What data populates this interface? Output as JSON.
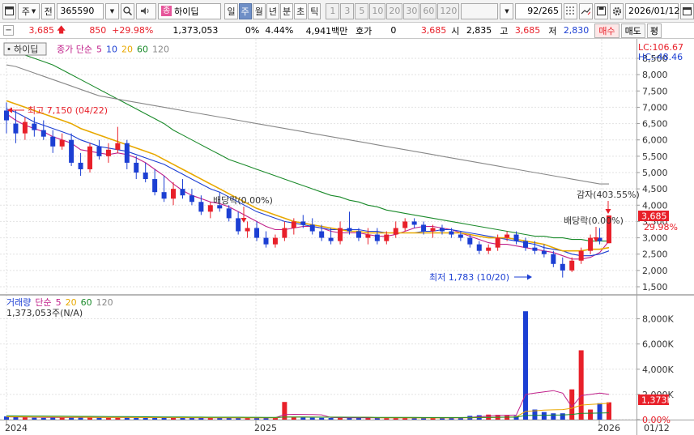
{
  "toolbar": {
    "market_label": "주",
    "all_label": "전",
    "stock_code": "365590",
    "stock_badge": "종",
    "stock_name": "하이딥",
    "periods": [
      "일",
      "주",
      "월",
      "년",
      "분",
      "초",
      "틱"
    ],
    "active_period": "주",
    "minute_opts": [
      "1",
      "3",
      "5",
      "10",
      "20",
      "30",
      "60",
      "120"
    ],
    "page_counter": "92/265",
    "date": "2026/01/12"
  },
  "quote": {
    "price": "3,685",
    "change": "850",
    "change_pct": "+29.98%",
    "volume": "1,373,053",
    "zero_pct": "0%",
    "turnover_pct": "4.44%",
    "amount": "4,941백만",
    "quote_label": "호가",
    "quote_value": "0",
    "quote_price": "3,685",
    "open_label": "시",
    "open": "2,835",
    "high_label": "고",
    "high": "3,685",
    "low_label": "저",
    "low": "2,830",
    "buy_label": "매수",
    "sell_label": "매도",
    "eval_label": "평"
  },
  "price_panel": {
    "name_tag": "하이딥",
    "legend": [
      {
        "text": "종가 단순",
        "color": "#c0208a"
      },
      {
        "text": "5",
        "color": "#c0208a"
      },
      {
        "text": "10",
        "color": "#1c3fd3"
      },
      {
        "text": "20",
        "color": "#e8a800"
      },
      {
        "text": "60",
        "color": "#1a8a2a"
      },
      {
        "text": "120",
        "color": "#888888"
      }
    ],
    "lc": "LC:106.67",
    "hc": "HC:-48.46",
    "high_note": "최고 7,150 (04/22)",
    "low_note": "최저 1,783 (10/20)",
    "div_note1": "배당락(0.00%)",
    "div_note2": "배당락(0.00%)",
    "cap_note": "감자(403.55%)",
    "price_tag": "3,685",
    "pct_tag": "29.98%",
    "y_axis": [
      "8,500",
      "8,000",
      "7,500",
      "7,000",
      "6,500",
      "6,000",
      "5,500",
      "5,000",
      "4,500",
      "4,000",
      "3,500",
      "3,000",
      "2,500",
      "2,000",
      "1,500"
    ]
  },
  "volume_panel": {
    "legend": [
      {
        "text": "거래량",
        "color": "#1c3fd3"
      },
      {
        "text": "단순",
        "color": "#c0208a"
      },
      {
        "text": "5",
        "color": "#c0208a"
      },
      {
        "text": "20",
        "color": "#e8a800"
      },
      {
        "text": "60",
        "color": "#1a8a2a"
      },
      {
        "text": "120",
        "color": "#888888"
      }
    ],
    "vol_text": "1,373,053주(N/A)",
    "y_axis": [
      "8,000K",
      "6,000K",
      "4,000K",
      "2,000K",
      "0.00%"
    ],
    "vol_tag": "1,373K"
  },
  "x_axis": {
    "labels": [
      "2024",
      "2025",
      "2026"
    ],
    "right_label": "01/12"
  },
  "colors": {
    "up": "#e8202a",
    "down": "#1c3fd3",
    "ma5": "#c0208a",
    "ma10": "#1c3fd3",
    "ma20": "#e8a800",
    "ma60": "#1a8a2a",
    "ma120": "#888888"
  },
  "chart_data": {
    "type": "candlestick",
    "x_start": "2024-01",
    "x_end": "2026-01-12",
    "ylim": [
      1500,
      8500
    ],
    "candles": [
      [
        6900,
        7150,
        6200,
        6600
      ],
      [
        6500,
        6900,
        5900,
        6200
      ],
      [
        6200,
        6700,
        6000,
        6550
      ],
      [
        6500,
        6700,
        6100,
        6300
      ],
      [
        6300,
        6600,
        6000,
        6100
      ],
      [
        6100,
        6300,
        5600,
        5800
      ],
      [
        5800,
        6200,
        5700,
        6000
      ],
      [
        6000,
        6200,
        5200,
        5300
      ],
      [
        5300,
        5600,
        4900,
        5100
      ],
      [
        5100,
        5900,
        5000,
        5800
      ],
      [
        5800,
        6000,
        5400,
        5500
      ],
      [
        5500,
        5900,
        5300,
        5700
      ],
      [
        5700,
        6400,
        5600,
        5900
      ],
      [
        5900,
        6000,
        5100,
        5300
      ],
      [
        5300,
        5500,
        4800,
        5000
      ],
      [
        5000,
        5300,
        4700,
        4800
      ],
      [
        4800,
        5100,
        4300,
        4400
      ],
      [
        4400,
        4900,
        4100,
        4200
      ],
      [
        4200,
        4700,
        4000,
        4500
      ],
      [
        4500,
        4800,
        4200,
        4300
      ],
      [
        4300,
        4500,
        4000,
        4100
      ],
      [
        4100,
        4300,
        3700,
        3800
      ],
      [
        3800,
        4100,
        3600,
        4000
      ],
      [
        4000,
        4400,
        3800,
        3900
      ],
      [
        3900,
        4000,
        3500,
        3600
      ],
      [
        3600,
        3800,
        3100,
        3200
      ],
      [
        3200,
        3500,
        3000,
        3300
      ],
      [
        3300,
        3500,
        2900,
        3000
      ],
      [
        3000,
        3200,
        2700,
        2800
      ],
      [
        2800,
        3100,
        2700,
        3000
      ],
      [
        3000,
        3500,
        2900,
        3300
      ],
      [
        3300,
        3600,
        3100,
        3500
      ],
      [
        3500,
        3700,
        3300,
        3400
      ],
      [
        3400,
        3600,
        3100,
        3200
      ],
      [
        3200,
        3400,
        2900,
        3000
      ],
      [
        3000,
        3300,
        2800,
        2900
      ],
      [
        2900,
        3500,
        2800,
        3300
      ],
      [
        3300,
        3800,
        3100,
        3200
      ],
      [
        3200,
        3300,
        2900,
        3000
      ],
      [
        3000,
        3300,
        2800,
        3100
      ],
      [
        3100,
        3300,
        2800,
        2900
      ],
      [
        2900,
        3200,
        2800,
        3100
      ],
      [
        3100,
        3500,
        3000,
        3300
      ],
      [
        3300,
        3600,
        3200,
        3500
      ],
      [
        3500,
        3600,
        3300,
        3400
      ],
      [
        3400,
        3500,
        3100,
        3200
      ],
      [
        3200,
        3400,
        3000,
        3300
      ],
      [
        3300,
        3400,
        3100,
        3200
      ],
      [
        3200,
        3300,
        3000,
        3100
      ],
      [
        3100,
        3200,
        2900,
        3000
      ],
      [
        3000,
        3100,
        2700,
        2800
      ],
      [
        2800,
        2900,
        2500,
        2600
      ],
      [
        2600,
        2800,
        2500,
        2700
      ],
      [
        2700,
        3100,
        2600,
        3000
      ],
      [
        3000,
        3200,
        2900,
        3100
      ],
      [
        3100,
        3200,
        2800,
        2900
      ],
      [
        2900,
        3000,
        2600,
        2700
      ],
      [
        2700,
        2900,
        2500,
        2600
      ],
      [
        2600,
        2800,
        2400,
        2500
      ],
      [
        2500,
        2600,
        2100,
        2200
      ],
      [
        2200,
        2400,
        1783,
        2000
      ],
      [
        2000,
        2400,
        1950,
        2300
      ],
      [
        2300,
        2700,
        2200,
        2600
      ],
      [
        2600,
        3100,
        2500,
        3000
      ],
      [
        3000,
        3300,
        2800,
        2900
      ],
      [
        2835,
        3685,
        2830,
        3685
      ]
    ],
    "volumes_k": [
      250,
      200,
      180,
      150,
      140,
      200,
      160,
      180,
      220,
      170,
      160,
      150,
      200,
      180,
      140,
      160,
      170,
      150,
      140,
      160,
      130,
      150,
      140,
      160,
      150,
      130,
      140,
      150,
      160,
      140,
      1400,
      170,
      160,
      150,
      140,
      130,
      150,
      160,
      170,
      140,
      130,
      120,
      130,
      140,
      150,
      130,
      120,
      140,
      150,
      160,
      300,
      350,
      400,
      380,
      350,
      300,
      8600,
      800,
      600,
      500,
      500,
      2400,
      5500,
      800,
      1300,
      1373
    ],
    "series": [
      {
        "name": "5",
        "values": [
          6800,
          6600,
          6450,
          6350,
          6250,
          6100,
          6000,
          5900,
          5700,
          5650,
          5600,
          5550,
          5600,
          5550,
          5450,
          5300,
          5100,
          4900,
          4650,
          4450,
          4300,
          4200,
          4100,
          4050,
          3950,
          3800,
          3650,
          3500,
          3350,
          3250,
          3250,
          3300,
          3350,
          3350,
          3300,
          3200,
          3150,
          3150,
          3150,
          3100,
          3050,
          3050,
          3100,
          3200,
          3300,
          3350,
          3350,
          3300,
          3250,
          3150,
          3050,
          2950,
          2850,
          2800,
          2800,
          2750,
          2700,
          2650,
          2600,
          2550,
          2450,
          2350,
          2350,
          2400,
          2550,
          2900
        ]
      },
      {
        "name": "10",
        "values": [
          6950,
          6850,
          6700,
          6550,
          6450,
          6350,
          6250,
          6150,
          6000,
          5900,
          5800,
          5750,
          5700,
          5650,
          5550,
          5450,
          5350,
          5250,
          5100,
          4950,
          4800,
          4650,
          4500,
          4400,
          4250,
          4100,
          3950,
          3800,
          3700,
          3600,
          3500,
          3450,
          3400,
          3350,
          3300,
          3250,
          3250,
          3250,
          3250,
          3200,
          3200,
          3150,
          3150,
          3150,
          3150,
          3200,
          3200,
          3250,
          3250,
          3200,
          3150,
          3100,
          3050,
          3000,
          2950,
          2900,
          2850,
          2800,
          2700,
          2650,
          2600,
          2500,
          2450,
          2450,
          2500,
          2600
        ]
      },
      {
        "name": "20",
        "values": [
          7200,
          7100,
          7000,
          6900,
          6800,
          6700,
          6600,
          6500,
          6350,
          6250,
          6150,
          6050,
          5950,
          5850,
          5750,
          5650,
          5550,
          5400,
          5250,
          5100,
          4950,
          4800,
          4650,
          4500,
          4350,
          4200,
          4050,
          3900,
          3800,
          3700,
          3600,
          3500,
          3450,
          3400,
          3350,
          3300,
          3250,
          3200,
          3200,
          3150,
          3150,
          3150,
          3150,
          3150,
          3150,
          3150,
          3150,
          3150,
          3150,
          3150,
          3100,
          3050,
          3000,
          3000,
          3000,
          2950,
          2900,
          2850,
          2800,
          2700,
          2600,
          2600,
          2600,
          2650,
          2650,
          2700
        ]
      },
      {
        "name": "60",
        "values": [
          8700,
          8650,
          8600,
          8500,
          8400,
          8300,
          8150,
          8000,
          7850,
          7700,
          7550,
          7400,
          7250,
          7100,
          6950,
          6800,
          6650,
          6500,
          6300,
          6150,
          6000,
          5850,
          5700,
          5550,
          5400,
          5300,
          5200,
          5100,
          5000,
          4900,
          4800,
          4700,
          4600,
          4500,
          4400,
          4300,
          4250,
          4150,
          4100,
          4000,
          3950,
          3850,
          3800,
          3750,
          3700,
          3650,
          3600,
          3550,
          3500,
          3450,
          3400,
          3350,
          3300,
          3250,
          3200,
          3150,
          3100,
          3050,
          3050,
          3000,
          3000,
          2950,
          2950,
          2900,
          2900,
          2900
        ]
      },
      {
        "name": "120",
        "values": [
          8300,
          8250,
          8150,
          8050,
          7950,
          7850,
          7750,
          7650,
          7550,
          7450,
          7350,
          7300,
          7250,
          7200,
          7150,
          7100,
          7050,
          7000,
          6950,
          6900,
          6850,
          6800,
          6750,
          6700,
          6650,
          6600,
          6550,
          6500,
          6450,
          6400,
          6350,
          6300,
          6250,
          6200,
          6150,
          6100,
          6050,
          6000,
          5950,
          5900,
          5850,
          5800,
          5750,
          5700,
          5650,
          5600,
          5550,
          5500,
          5450,
          5400,
          5350,
          5300,
          5250,
          5200,
          5150,
          5100,
          5050,
          5000,
          4950,
          4900,
          4850,
          4800,
          4750,
          4700,
          4650,
          4650
        ]
      }
    ],
    "vol_ma": [
      {
        "name": "5",
        "values": [
          220,
          210,
          200,
          190,
          180,
          175,
          170,
          170,
          175,
          175,
          170,
          165,
          170,
          170,
          165,
          160,
          160,
          160,
          155,
          155,
          150,
          150,
          150,
          150,
          150,
          145,
          145,
          145,
          150,
          150,
          400,
          420,
          410,
          400,
          380,
          170,
          160,
          150,
          150,
          150,
          145,
          140,
          135,
          135,
          140,
          140,
          135,
          135,
          140,
          145,
          180,
          230,
          280,
          330,
          350,
          360,
          2000,
          2100,
          2200,
          2300,
          2100,
          1000,
          1900,
          2000,
          2100,
          2000
        ]
      },
      {
        "name": "20",
        "values": [
          230,
          225,
          220,
          215,
          210,
          205,
          200,
          195,
          190,
          185,
          180,
          175,
          175,
          175,
          170,
          170,
          165,
          165,
          165,
          160,
          160,
          160,
          155,
          155,
          155,
          150,
          150,
          150,
          150,
          150,
          210,
          210,
          210,
          205,
          200,
          200,
          200,
          195,
          195,
          190,
          140,
          140,
          140,
          140,
          135,
          135,
          135,
          135,
          140,
          140,
          150,
          160,
          170,
          180,
          200,
          220,
          650,
          700,
          750,
          780,
          800,
          900,
          1150,
          1200,
          1250,
          1300
        ]
      },
      {
        "name": "60",
        "values": [
          300,
          295,
          290,
          285,
          280,
          275,
          270,
          265,
          260,
          255,
          250,
          245,
          240,
          235,
          230,
          225,
          220,
          215,
          210,
          205,
          200,
          200,
          195,
          195,
          190,
          190,
          185,
          185,
          180,
          180,
          200,
          200,
          200,
          195,
          195,
          190,
          190,
          190,
          185,
          185,
          180,
          180,
          175,
          175,
          175,
          170,
          170,
          170,
          170,
          170,
          175,
          175,
          180,
          185,
          190,
          195,
          330,
          340,
          350,
          360,
          370,
          410,
          500,
          510,
          520,
          540
        ]
      }
    ]
  }
}
